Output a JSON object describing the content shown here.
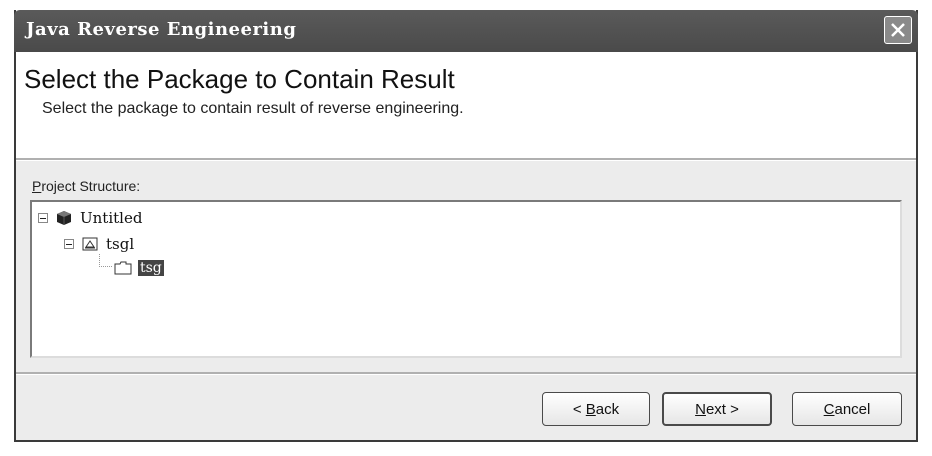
{
  "window": {
    "title": "Java Reverse Engineering"
  },
  "header": {
    "title": "Select the Package to Contain Result",
    "subtitle": "Select the package to contain result of reverse engineering."
  },
  "project_structure": {
    "label_mnemonic": "P",
    "label_rest": "roject Structure:",
    "tree": [
      {
        "label": "Untitled",
        "icon": "project-icon",
        "expanded": true,
        "level": 0
      },
      {
        "label": "tsgl",
        "icon": "package-icon",
        "expanded": true,
        "level": 1
      },
      {
        "label": "tsg",
        "icon": "folder-icon",
        "selected": true,
        "level": 2
      }
    ]
  },
  "buttons": {
    "back_prefix": "< ",
    "back_mnemonic": "B",
    "back_rest": "ack",
    "next_mnemonic": "N",
    "next_rest": "ext >",
    "cancel_mnemonic": "C",
    "cancel_rest": "ancel"
  }
}
